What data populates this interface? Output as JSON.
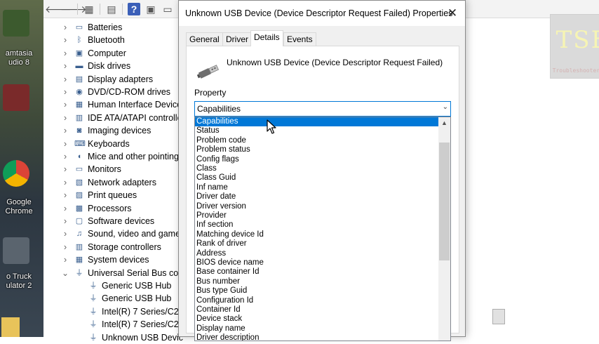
{
  "desktop": {
    "icons": [
      {
        "label": "amtasia\nudio 8"
      },
      {
        "label": ""
      },
      {
        "label": "Google\nChrome"
      },
      {
        "label": "o Truck\nulator 2"
      }
    ]
  },
  "device_manager": {
    "tree": [
      {
        "label": "Batteries",
        "expanded": false,
        "level": 0,
        "icon": "battery-icon"
      },
      {
        "label": "Bluetooth",
        "expanded": false,
        "level": 0,
        "icon": "bluetooth-icon"
      },
      {
        "label": "Computer",
        "expanded": false,
        "level": 0,
        "icon": "computer-icon"
      },
      {
        "label": "Disk drives",
        "expanded": false,
        "level": 0,
        "icon": "disk-icon"
      },
      {
        "label": "Display adapters",
        "expanded": false,
        "level": 0,
        "icon": "display-icon"
      },
      {
        "label": "DVD/CD-ROM drives",
        "expanded": false,
        "level": 0,
        "icon": "dvd-icon"
      },
      {
        "label": "Human Interface Device",
        "expanded": false,
        "level": 0,
        "icon": "hid-icon"
      },
      {
        "label": "IDE ATA/ATAPI controlle",
        "expanded": false,
        "level": 0,
        "icon": "ide-icon"
      },
      {
        "label": "Imaging devices",
        "expanded": false,
        "level": 0,
        "icon": "camera-icon"
      },
      {
        "label": "Keyboards",
        "expanded": false,
        "level": 0,
        "icon": "keyboard-icon"
      },
      {
        "label": "Mice and other pointing",
        "expanded": false,
        "level": 0,
        "icon": "mouse-icon"
      },
      {
        "label": "Monitors",
        "expanded": false,
        "level": 0,
        "icon": "monitor-icon"
      },
      {
        "label": "Network adapters",
        "expanded": false,
        "level": 0,
        "icon": "network-icon"
      },
      {
        "label": "Print queues",
        "expanded": false,
        "level": 0,
        "icon": "printer-icon"
      },
      {
        "label": "Processors",
        "expanded": false,
        "level": 0,
        "icon": "processor-icon"
      },
      {
        "label": "Software devices",
        "expanded": false,
        "level": 0,
        "icon": "software-icon"
      },
      {
        "label": "Sound, video and game",
        "expanded": false,
        "level": 0,
        "icon": "sound-icon"
      },
      {
        "label": "Storage controllers",
        "expanded": false,
        "level": 0,
        "icon": "storage-icon"
      },
      {
        "label": "System devices",
        "expanded": false,
        "level": 0,
        "icon": "system-icon"
      },
      {
        "label": "Universal Serial Bus con",
        "expanded": true,
        "level": 0,
        "icon": "usb-icon"
      },
      {
        "label": "Generic USB Hub",
        "level": 1,
        "icon": "usb-plug-icon"
      },
      {
        "label": "Generic USB Hub",
        "level": 1,
        "icon": "usb-plug-icon"
      },
      {
        "label": "Intel(R) 7 Series/C21",
        "level": 1,
        "icon": "usb-plug-icon"
      },
      {
        "label": "Intel(R) 7 Series/C21",
        "level": 1,
        "icon": "usb-plug-icon"
      },
      {
        "label": "Unknown USB Devic",
        "level": 1,
        "icon": "usb-plug-icon"
      }
    ]
  },
  "watermark": {
    "big": "TSE",
    "small": "Troubleshooterrors"
  },
  "dialog": {
    "title": "Unknown USB Device (Device Descriptor Request Failed) Properties",
    "close_glyph": "✕",
    "tabs": [
      {
        "label": "General",
        "active": false
      },
      {
        "label": "Driver",
        "active": false
      },
      {
        "label": "Details",
        "active": true
      },
      {
        "label": "Events",
        "active": false
      }
    ],
    "device_name": "Unknown USB Device (Device Descriptor Request Failed)",
    "property_label": "Property",
    "selected_property": "Capabilities",
    "options": [
      "Capabilities",
      "Status",
      "Problem code",
      "Problem status",
      "Config flags",
      "Class",
      "Class Guid",
      "Inf name",
      "Driver date",
      "Driver version",
      "Provider",
      "Inf section",
      "Matching device Id",
      "Rank of driver",
      "Address",
      "BIOS device name",
      "Base container Id",
      "Bus number",
      "Bus type Guid",
      "Configuration Id",
      "Container Id",
      "Device stack",
      "Display name",
      "Driver description"
    ],
    "highlighted_index": 0
  }
}
